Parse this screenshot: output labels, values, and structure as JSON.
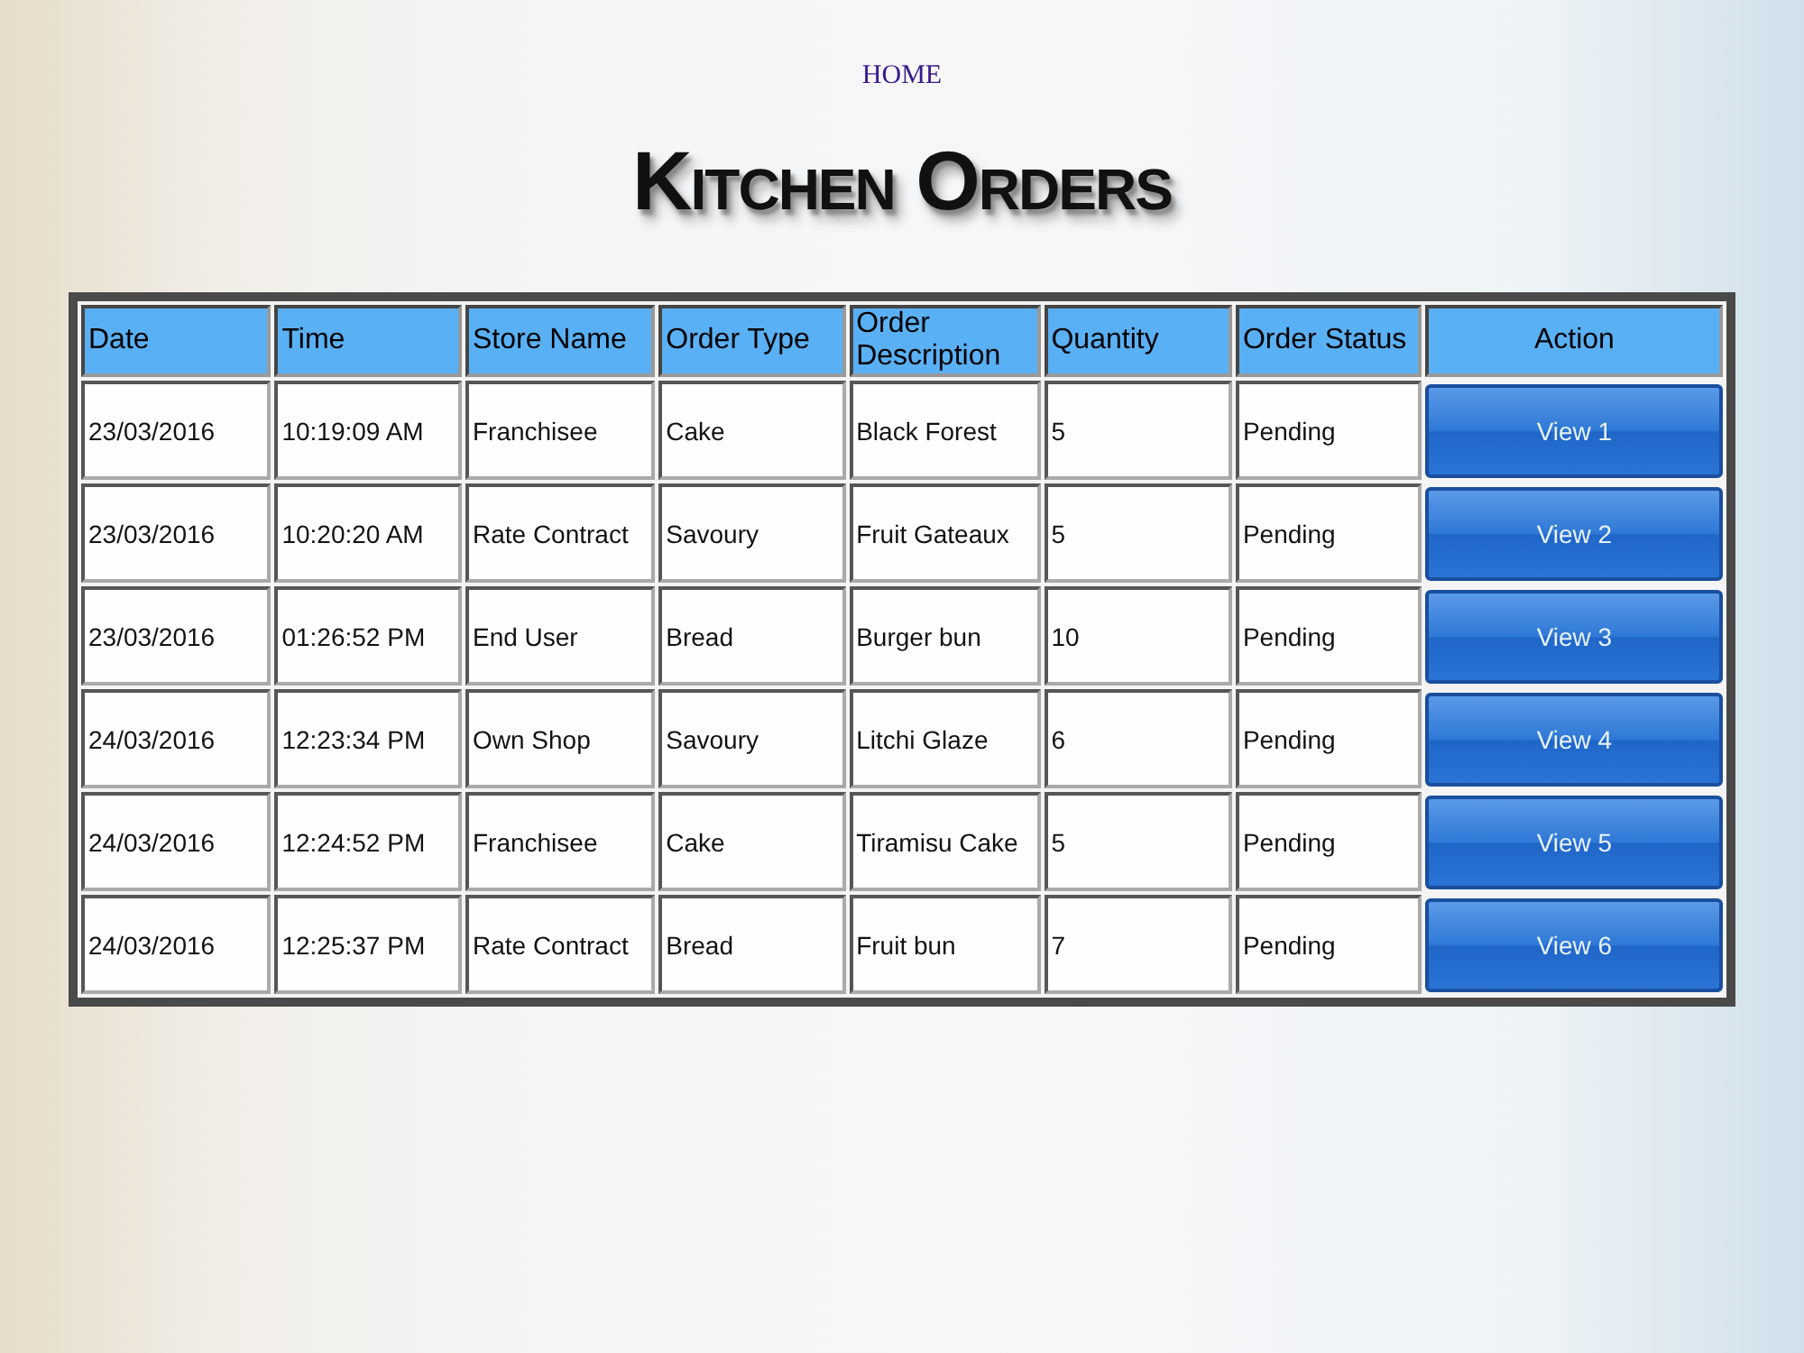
{
  "nav": {
    "home_link": "HOME"
  },
  "page_title": "Kitchen Orders",
  "table": {
    "columns": [
      "Date",
      "Time",
      "Store Name",
      "Order Type",
      "Order Description",
      "Quantity",
      "Order Status",
      "Action"
    ],
    "rows": [
      {
        "cells": [
          "23/03/2016",
          "10:19:09 AM",
          "Franchisee",
          "Cake",
          "Black Forest",
          "5",
          "Pending"
        ],
        "action": "View 1"
      },
      {
        "cells": [
          "23/03/2016",
          "10:20:20 AM",
          "Rate Contract",
          "Savoury",
          "Fruit Gateaux",
          "5",
          "Pending"
        ],
        "action": "View 2"
      },
      {
        "cells": [
          "23/03/2016",
          "01:26:52 PM",
          "End User",
          "Bread",
          "Burger bun",
          "10",
          "Pending"
        ],
        "action": "View 3"
      },
      {
        "cells": [
          "24/03/2016",
          "12:23:34 PM",
          "Own Shop",
          "Savoury",
          "Litchi Glaze",
          "6",
          "Pending"
        ],
        "action": "View 4"
      },
      {
        "cells": [
          "24/03/2016",
          "12:24:52 PM",
          "Franchisee",
          "Cake",
          "Tiramisu Cake",
          "5",
          "Pending"
        ],
        "action": "View 5"
      },
      {
        "cells": [
          "24/03/2016",
          "12:25:37 PM",
          "Rate Contract",
          "Bread",
          "Fruit bun",
          "7",
          "Pending"
        ],
        "action": "View 6"
      }
    ]
  }
}
